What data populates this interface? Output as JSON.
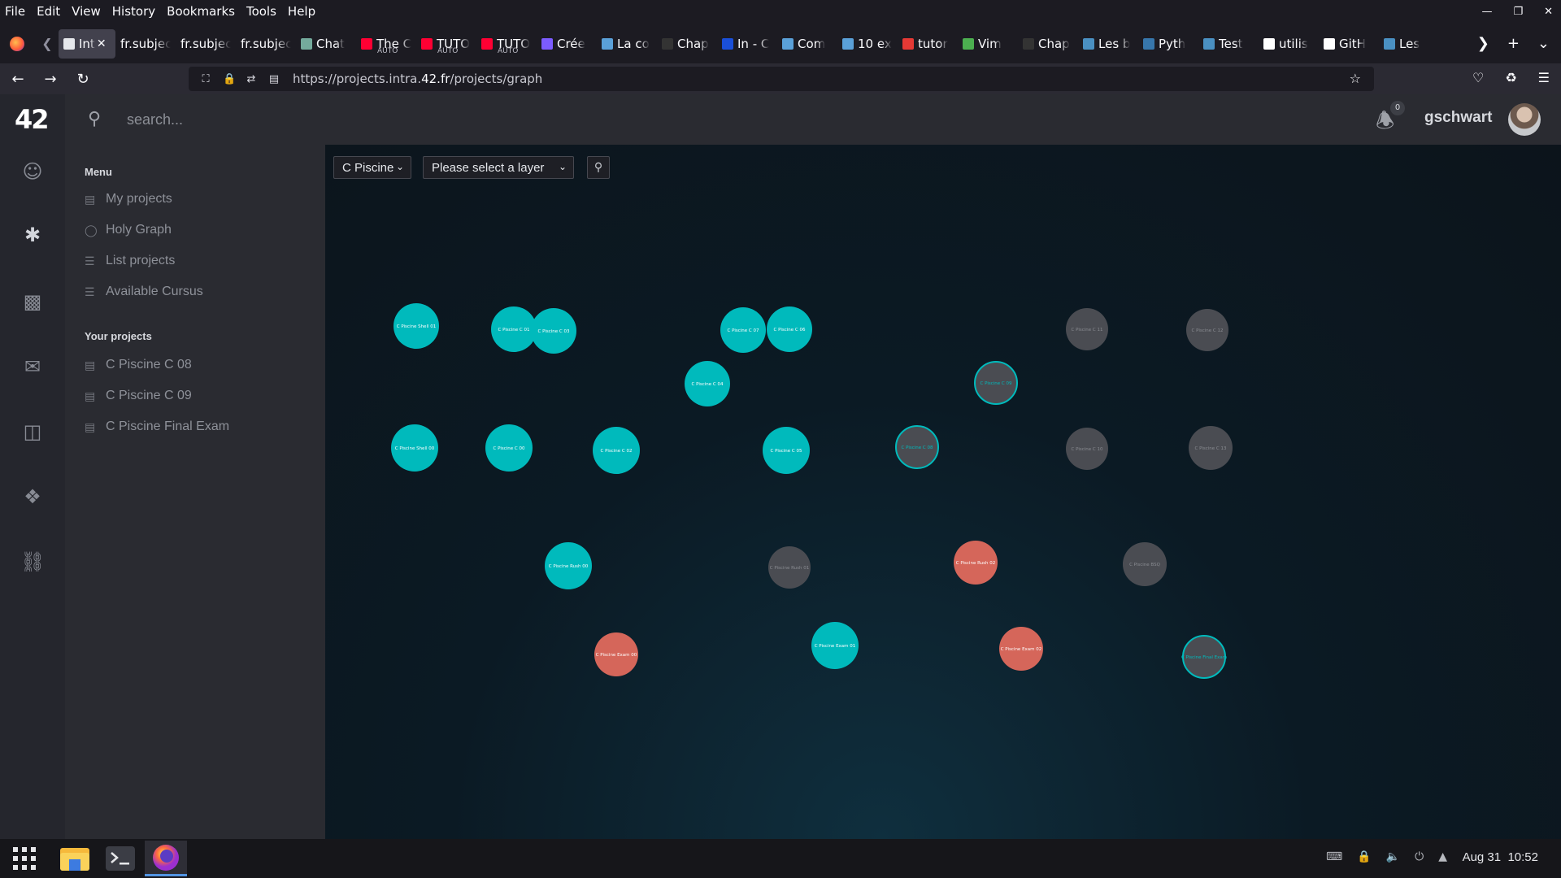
{
  "browser": {
    "menu": [
      "File",
      "Edit",
      "View",
      "History",
      "Bookmarks",
      "Tools",
      "Help"
    ],
    "tabs": [
      {
        "title": "Int",
        "favicon_color": "#e5e7eb",
        "active": true
      },
      {
        "title": "fr.subjec",
        "favicon_color": "",
        "active": false
      },
      {
        "title": "fr.subjec",
        "favicon_color": "",
        "active": false
      },
      {
        "title": "fr.subjec",
        "favicon_color": "",
        "active": false
      },
      {
        "title": "Chat",
        "favicon_color": "#74aa9c",
        "active": false
      },
      {
        "title": "The C",
        "sub": "AUTO",
        "favicon_color": "#ff0033",
        "active": false
      },
      {
        "title": "TUTO",
        "sub": "AUTO",
        "favicon_color": "#ff0033",
        "active": false
      },
      {
        "title": "TUTO",
        "sub": "AUTO",
        "favicon_color": "#ff0033",
        "active": false
      },
      {
        "title": "Crée",
        "favicon_color": "#7c5cff",
        "active": false
      },
      {
        "title": "La co",
        "favicon_color": "#5aa0d8",
        "active": false
      },
      {
        "title": "Chap",
        "favicon_color": "#333333",
        "active": false
      },
      {
        "title": "In - C",
        "favicon_color": "#1a4fd8",
        "active": false
      },
      {
        "title": "Com",
        "favicon_color": "#5aa0d8",
        "active": false
      },
      {
        "title": "10 ex",
        "favicon_color": "#5aa0d8",
        "active": false
      },
      {
        "title": "tutor",
        "favicon_color": "#e53935",
        "active": false
      },
      {
        "title": "Vim",
        "favicon_color": "#4caf50",
        "active": false
      },
      {
        "title": "Chap",
        "favicon_color": "#333333",
        "active": false
      },
      {
        "title": "Les b",
        "favicon_color": "#4a90c2",
        "active": false
      },
      {
        "title": "Pyth",
        "favicon_color": "#3776ab",
        "active": false
      },
      {
        "title": "Test",
        "favicon_color": "#4a90c2",
        "active": false
      },
      {
        "title": "utilis",
        "favicon_color": "#ffffff",
        "active": false
      },
      {
        "title": "GitH",
        "favicon_color": "#ffffff",
        "active": false
      },
      {
        "title": "Les",
        "favicon_color": "#4a90c2",
        "active": false
      }
    ],
    "url_prefix": "https://projects.intra.",
    "url_domain": "42.fr",
    "url_suffix": "/projects/graph"
  },
  "intra": {
    "logo": "42",
    "search_placeholder": "search...",
    "notifications_count": "0",
    "username": "gschwart",
    "menu_title": "Menu",
    "menu_items": [
      "My projects",
      "Holy Graph",
      "List projects",
      "Available Cursus"
    ],
    "your_projects_title": "Your projects",
    "your_projects": [
      "C Piscine C 08",
      "C Piscine C 09",
      "C Piscine Final Exam"
    ],
    "cursus_select": "C Piscine",
    "layer_select": "Please select a layer"
  },
  "colors": {
    "validated": "#00babc",
    "available": "#4a4c52",
    "in_progress": "#4a4c52",
    "failed": "#d5665a"
  },
  "graph_nodes": [
    {
      "label": "C Piscine Shell 01",
      "status": "validated"
    },
    {
      "label": "C Piscine C 01",
      "status": "validated"
    },
    {
      "label": "C Piscine C 03",
      "status": "validated"
    },
    {
      "label": "C Piscine C 07",
      "status": "validated"
    },
    {
      "label": "C Piscine C 06",
      "status": "validated"
    },
    {
      "label": "C Piscine C 11",
      "status": "available"
    },
    {
      "label": "C Piscine C 12",
      "status": "available"
    },
    {
      "label": "C Piscine C 04",
      "status": "validated"
    },
    {
      "label": "C Piscine C 09",
      "status": "in_progress"
    },
    {
      "label": "C Piscine Shell 00",
      "status": "validated"
    },
    {
      "label": "C Piscine C 00",
      "status": "validated"
    },
    {
      "label": "C Piscine C 02",
      "status": "validated"
    },
    {
      "label": "C Piscine C 05",
      "status": "validated"
    },
    {
      "label": "C Piscine C 08",
      "status": "in_progress"
    },
    {
      "label": "C Piscine C 10",
      "status": "available"
    },
    {
      "label": "C Piscine C 13",
      "status": "available"
    },
    {
      "label": "C Piscine Rush 00",
      "status": "validated"
    },
    {
      "label": "C Piscine Rush 01",
      "status": "available"
    },
    {
      "label": "C Piscine Rush 02",
      "status": "failed"
    },
    {
      "label": "C Piscine BSQ",
      "status": "available"
    },
    {
      "label": "C Piscine Exam 00",
      "status": "failed"
    },
    {
      "label": "C Piscine Exam 01",
      "status": "validated"
    },
    {
      "label": "C Piscine Exam 02",
      "status": "failed"
    },
    {
      "label": "C Piscine Final Exam",
      "status": "in_progress"
    }
  ],
  "taskbar": {
    "date": "Aug 31",
    "time": "10:52"
  }
}
